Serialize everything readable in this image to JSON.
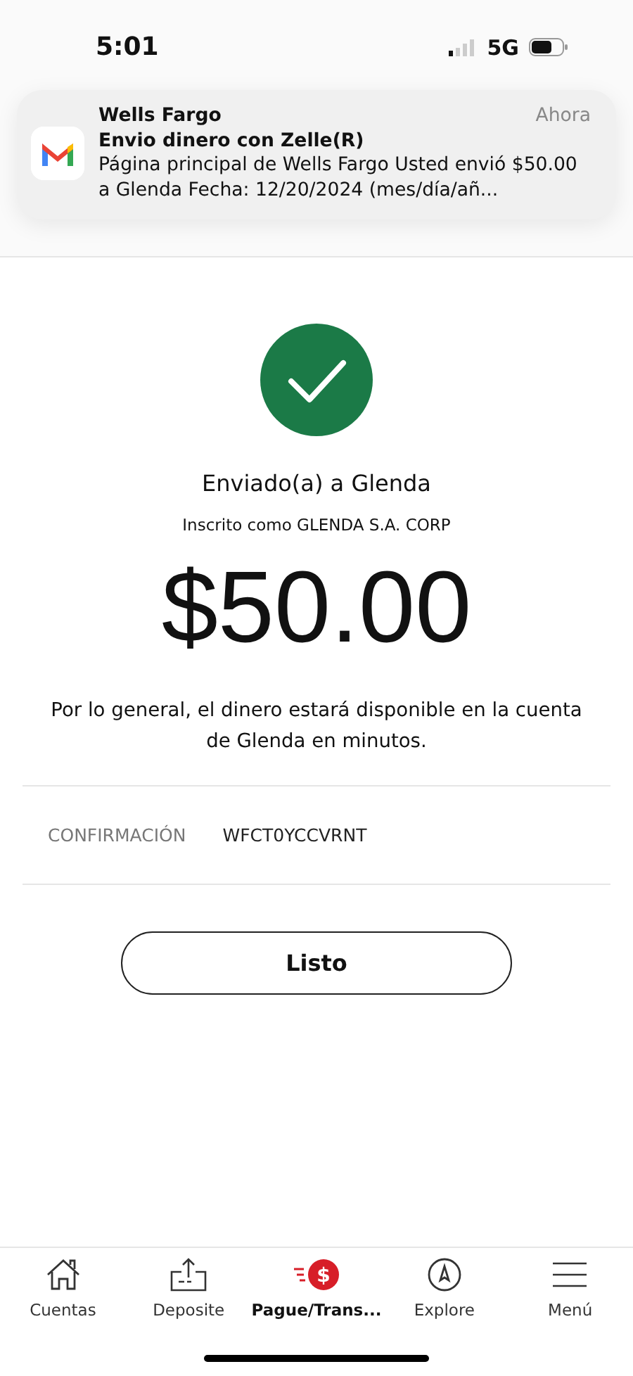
{
  "status_bar": {
    "time": "5:01",
    "network": "5G"
  },
  "notification": {
    "app": "Wells Fargo",
    "time": "Ahora",
    "title": "Envio dinero con Zelle(R)",
    "body": "Página principal de Wells Fargo Usted envió $50.00 a Glenda Fecha: 12/20/2024 (mes/día/añ..."
  },
  "confirmation": {
    "heading": "Enviado(a) a Glenda",
    "subheading": "Inscrito como GLENDA S.A. CORP",
    "amount": "$50.00",
    "message": "Por lo general, el dinero estará disponible en la cuenta de Glenda en minutos.",
    "label": "CONFIRMACIÓN",
    "code": "WFCT0YCCVRNT",
    "button": "Listo"
  },
  "tab_bar": [
    {
      "kind": "home",
      "label": "Cuentas",
      "selected": false
    },
    {
      "kind": "deposit",
      "label": "Deposite",
      "selected": false
    },
    {
      "kind": "pay",
      "icon_text": "$",
      "label": "Pague/Trans...",
      "selected": true
    },
    {
      "kind": "compass",
      "label": "Explore",
      "selected": false
    },
    {
      "kind": "menu",
      "label": "Menú",
      "selected": false
    }
  ]
}
